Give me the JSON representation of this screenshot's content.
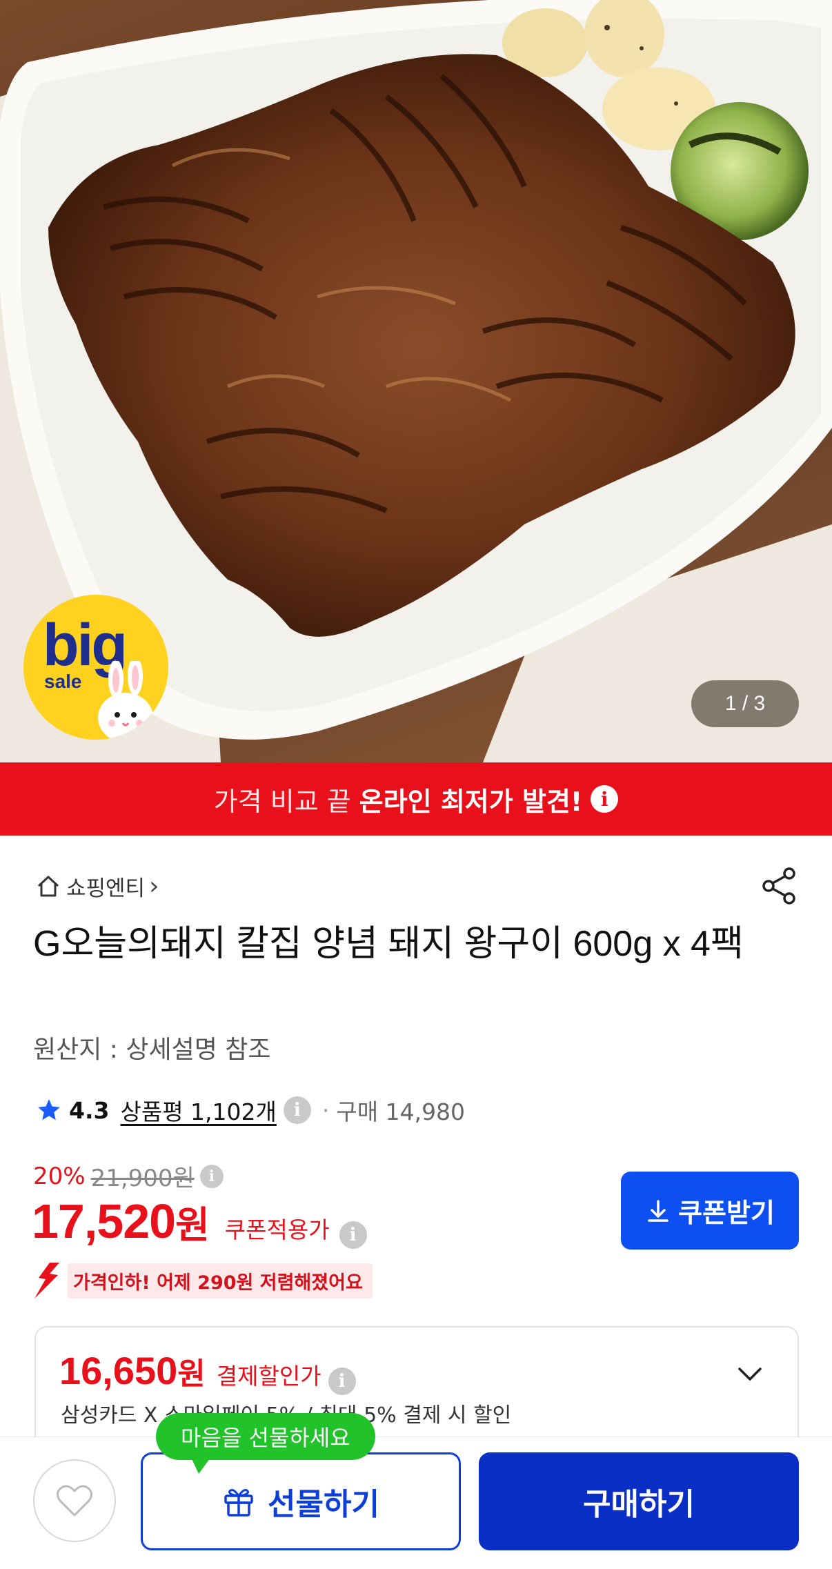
{
  "hero": {
    "badge_big": "big",
    "badge_sale": "sale",
    "pager": "1 / 3"
  },
  "banner": {
    "text_light": "가격 비교 끝",
    "text_bold": "온라인 최저가 발견!",
    "info_icon": "info-icon"
  },
  "store": {
    "name": "쇼핑엔티",
    "home_icon": "home-icon",
    "chevron": "›"
  },
  "product": {
    "title": "G오늘의돼지 칼집 양념 돼지 왕구이 600g x 4팩",
    "origin": "원산지 : 상세설명 참조",
    "rating": "4.3",
    "reviews": "상품평 1,102개",
    "purchases": "구매 14,980"
  },
  "pricing": {
    "discount_pct": "20%",
    "original_price": "21,900원",
    "coupon_price": "17,520",
    "coupon_price_unit": "원",
    "coupon_price_label": "쿠폰적용가",
    "coupon_button": "쿠폰받기",
    "price_drop_text": "가격인하! 어제 290원 저렴해졌어요",
    "pay_price": "16,650",
    "pay_price_unit": "원",
    "pay_price_label": "결제할인가",
    "pay_desc": "삼성카드 X 스마일페이 5% / 최대 5% 결제 시 할인"
  },
  "bottom": {
    "gift_tooltip": "마음을 선물하세요",
    "gift_button": "선물하기",
    "buy_button": "구매하기"
  },
  "colors": {
    "accent_red": "#e8101a",
    "primary_blue": "#0d4ff0",
    "buy_blue": "#0a2fc6",
    "tooltip_green": "#22c22b",
    "badge_yellow": "#ffd21f"
  }
}
